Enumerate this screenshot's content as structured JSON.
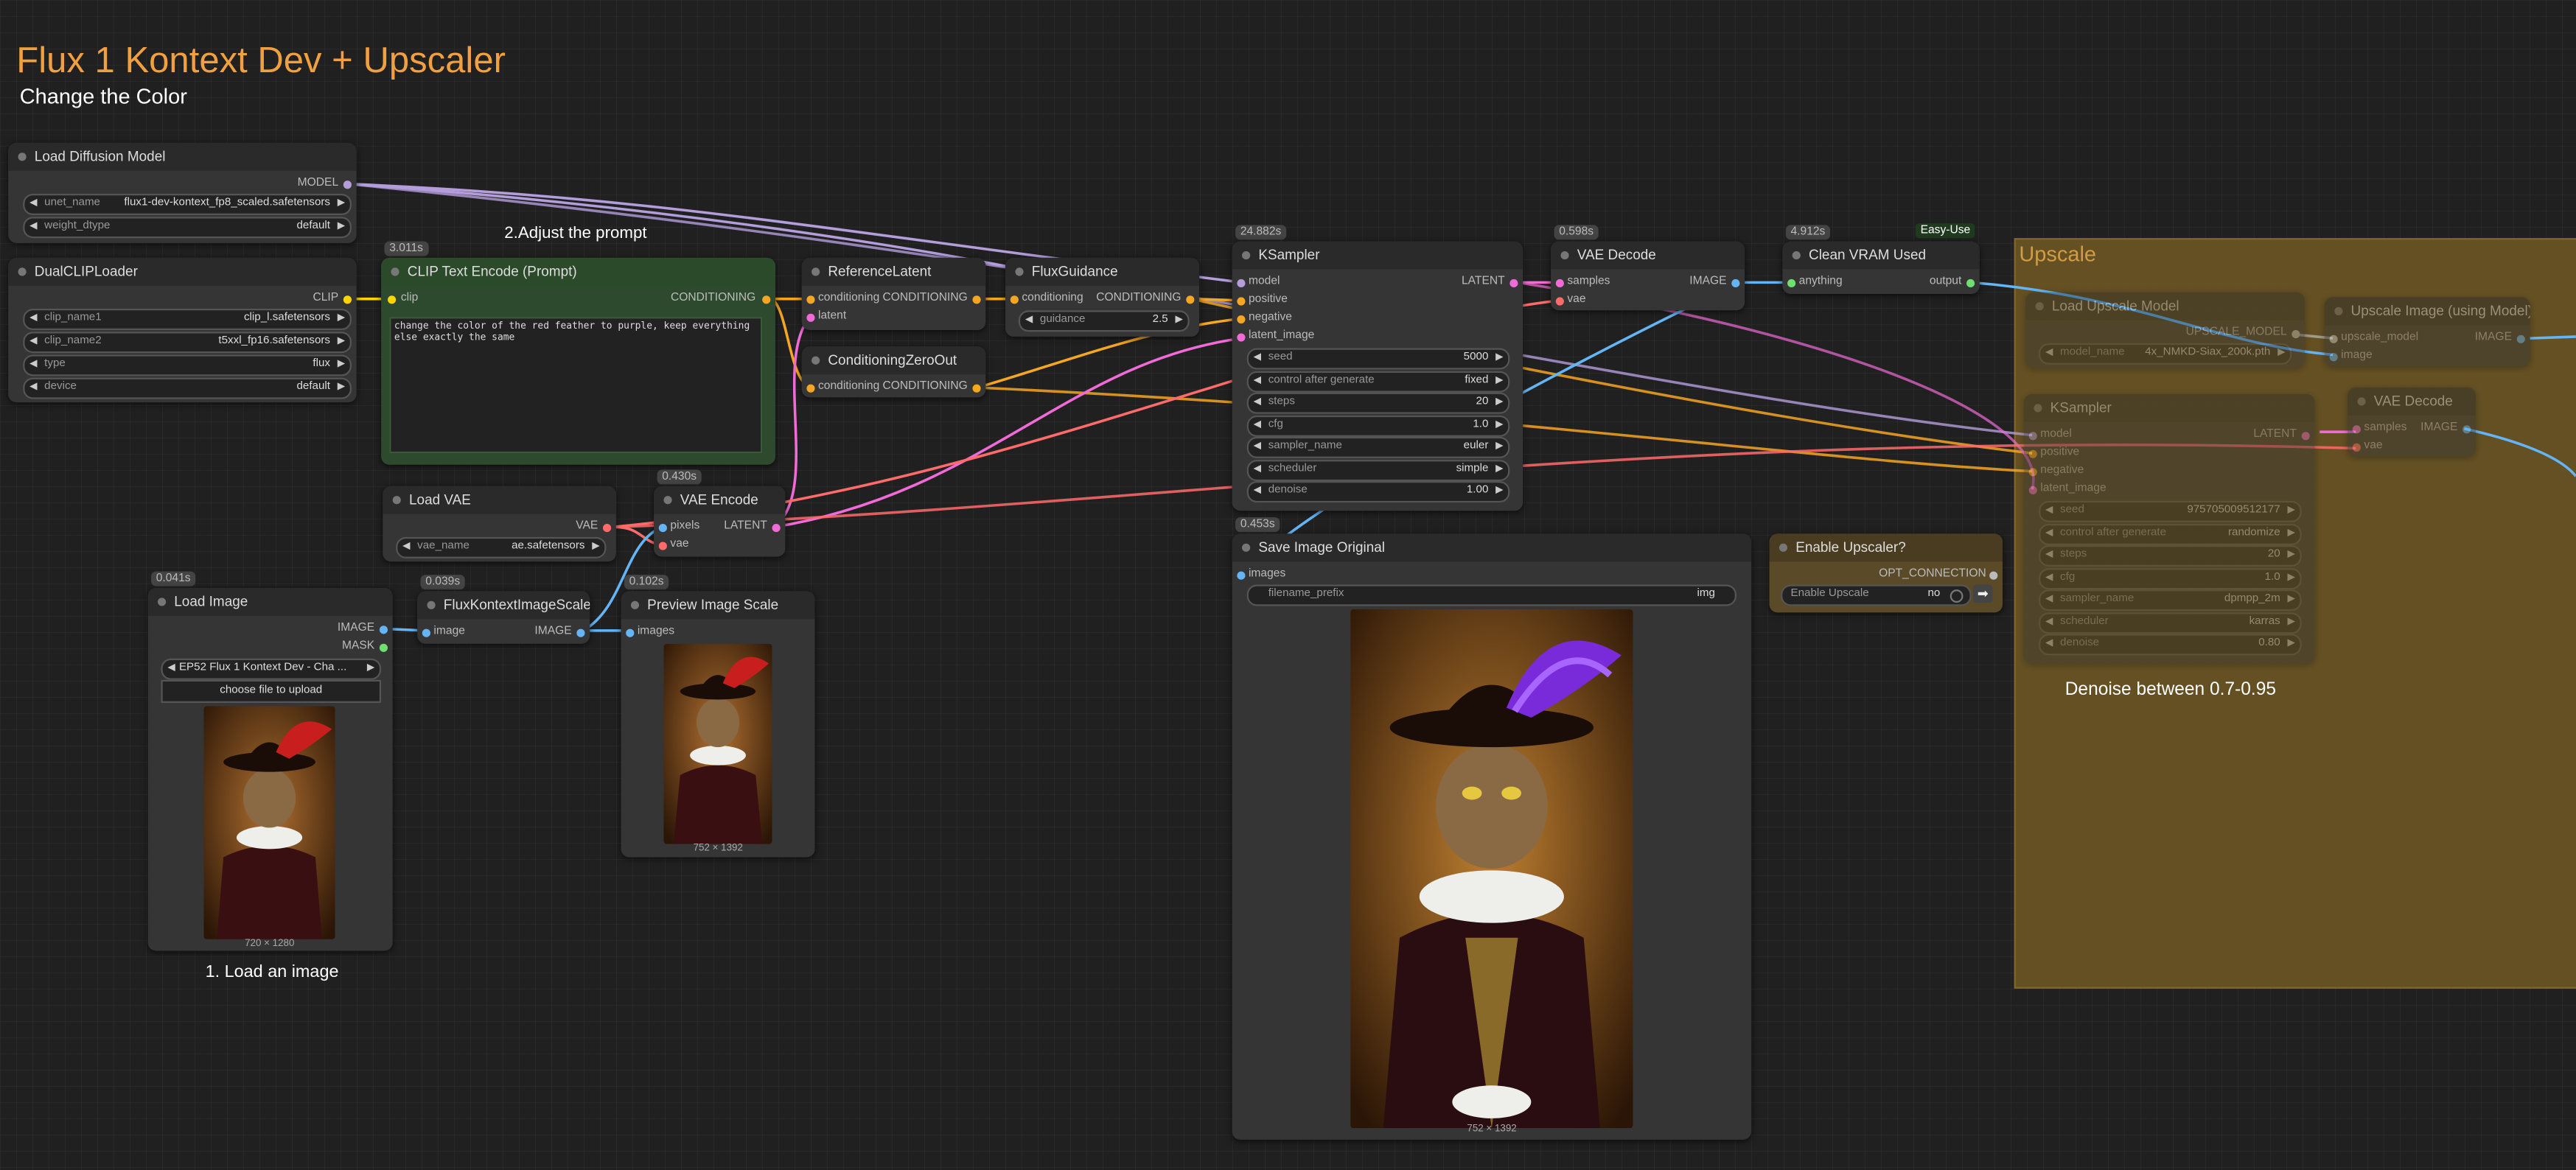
{
  "canvas": {
    "title": "Flux 1 Kontext Dev + Upscaler",
    "subtitle": "Change the Color",
    "note_prompt": "2.Adjust the prompt",
    "note_load": "1. Load an image",
    "note_denoise": "Denoise between 0.7-0.95",
    "group_upscale": "Upscale",
    "tag_easy_use": "Easy-Use"
  },
  "colors": {
    "accent_title": "#f0a040",
    "conditioning": "#f5a623",
    "model": "#b39ddb",
    "latent": "#f06bd7",
    "vae": "#ff6b6b",
    "image": "#64b5f6",
    "clip": "#ffd500"
  },
  "nodes": {
    "load_diffusion": {
      "title": "Load Diffusion Model",
      "out_model": "MODEL",
      "unet_label": "unet_name",
      "unet_value": "flux1-dev-kontext_fp8_scaled.safetensors",
      "dtype_label": "weight_dtype",
      "dtype_value": "default"
    },
    "dual_clip": {
      "title": "DualCLIPLoader",
      "out_clip": "CLIP",
      "clip1_label": "clip_name1",
      "clip1_value": "clip_l.safetensors",
      "clip2_label": "clip_name2",
      "clip2_value": "t5xxl_fp16.safetensors",
      "type_label": "type",
      "type_value": "flux",
      "device_label": "device",
      "device_value": "default"
    },
    "clip_encode": {
      "badge": "3.011s",
      "title": "CLIP Text Encode (Prompt)",
      "in_clip": "clip",
      "out_cond": "CONDITIONING",
      "prompt": "change the color of the red feather to purple, keep everything else exactly the same"
    },
    "ref_latent": {
      "title": "ReferenceLatent",
      "in_cond": "conditioning",
      "in_latent": "latent",
      "out_cond": "CONDITIONING"
    },
    "cond_zero": {
      "title": "ConditioningZeroOut",
      "in_cond": "conditioning",
      "out_cond": "CONDITIONING"
    },
    "flux_guidance": {
      "title": "FluxGuidance",
      "in_cond": "conditioning",
      "out_cond": "CONDITIONING",
      "guidance_label": "guidance",
      "guidance_value": "2.5"
    },
    "ksampler": {
      "badge": "24.882s",
      "title": "KSampler",
      "in_model": "model",
      "in_positive": "positive",
      "in_negative": "negative",
      "in_latent": "latent_image",
      "out_latent": "LATENT",
      "widgets": [
        {
          "label": "seed",
          "value": "5000"
        },
        {
          "label": "control after generate",
          "value": "fixed"
        },
        {
          "label": "steps",
          "value": "20"
        },
        {
          "label": "cfg",
          "value": "1.0"
        },
        {
          "label": "sampler_name",
          "value": "euler"
        },
        {
          "label": "scheduler",
          "value": "simple"
        },
        {
          "label": "denoise",
          "value": "1.00"
        }
      ]
    },
    "vae_decode": {
      "badge": "0.598s",
      "title": "VAE Decode",
      "in_samples": "samples",
      "in_vae": "vae",
      "out_image": "IMAGE"
    },
    "clean_vram": {
      "badge": "4.912s",
      "title": "Clean VRAM Used",
      "in_anything": "anything",
      "out_output": "output"
    },
    "load_vae": {
      "title": "Load VAE",
      "out_vae": "VAE",
      "vae_label": "vae_name",
      "vae_value": "ae.safetensors"
    },
    "vae_encode": {
      "badge": "0.430s",
      "title": "VAE Encode",
      "in_pixels": "pixels",
      "in_vae": "vae",
      "out_latent": "LATENT"
    },
    "save_image": {
      "badge": "0.453s",
      "title": "Save Image Original",
      "in_images": "images",
      "prefix_label": "filename_prefix",
      "prefix_value": "img",
      "dims": "752 × 1392"
    },
    "enable_upscaler": {
      "title": "Enable Upscaler?",
      "out_opt": "OPT_CONNECTION",
      "toggle_label": "Enable Upscale",
      "toggle_value": "no"
    },
    "load_image": {
      "badge": "0.041s",
      "title": "Load Image",
      "out_image": "IMAGE",
      "out_mask": "MASK",
      "file_value": "EP52 Flux 1 Kontext Dev - Cha ...",
      "upload_label": "choose file to upload",
      "dims": "720 × 1280"
    },
    "kontext_scale": {
      "badge": "0.039s",
      "title": "FluxKontextImageScale",
      "in_image": "image",
      "out_image": "IMAGE"
    },
    "preview_scale": {
      "badge": "0.102s",
      "title": "Preview Image Scale",
      "in_images": "images",
      "dims": "752 × 1392"
    },
    "load_upscale_model": {
      "title": "Load Upscale Model",
      "out_model": "UPSCALE_MODEL",
      "model_label": "model_name",
      "model_value": "4x_NMKD-Siax_200k.pth"
    },
    "upscale_image": {
      "title": "Upscale Image (using Model)",
      "in_model": "upscale_model",
      "in_image": "image",
      "out_image": "IMAGE"
    },
    "ksampler2": {
      "title": "KSampler",
      "in_model": "model",
      "in_positive": "positive",
      "in_negative": "negative",
      "in_latent": "latent_image",
      "out_latent": "LATENT",
      "widgets": [
        {
          "label": "seed",
          "value": "975705009512177"
        },
        {
          "label": "control after generate",
          "value": "randomize"
        },
        {
          "label": "steps",
          "value": "20"
        },
        {
          "label": "cfg",
          "value": "1.0"
        },
        {
          "label": "sampler_name",
          "value": "dpmpp_2m"
        },
        {
          "label": "scheduler",
          "value": "karras"
        },
        {
          "label": "denoise",
          "value": "0.80"
        }
      ]
    },
    "vae_decode2": {
      "title": "VAE Decode",
      "in_samples": "samples",
      "in_vae": "vae",
      "out_image": "IMAGE"
    }
  }
}
